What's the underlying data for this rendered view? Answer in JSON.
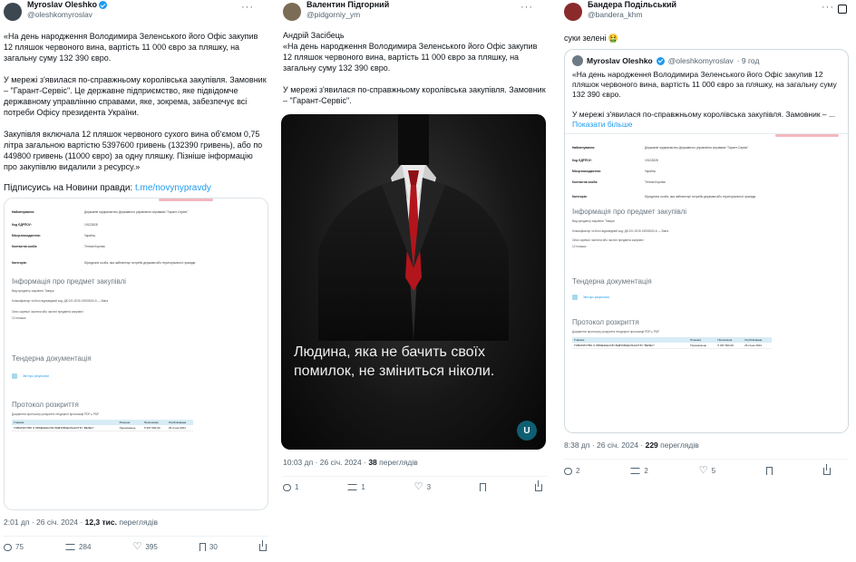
{
  "tweet1": {
    "name": "Myroslav Oleshko",
    "handle": "@oleshkomyroslav",
    "p1": "«На день народження Володимира Зеленського його Офіс закупив 12 пляшок червоного вина, вартість 11 000 євро за пляшку, на загальну суму 132 390 євро.",
    "p2": "У мережі з'явилася по-справжньому королівська закупівля. Замовник – \"Гарант-Сервіс\". Це державне підприємство, яке підвідомче державному управлінню справами, яке, зокрема, забезпечує всі потреби Офісу президента України.",
    "p3": "Закупівля включала 12 пляшок червоного сухого вина об'ємом 0,75 літра загальною вартістю 5397600 гривень (132390 гривень), або по 449800 гривень (11000 євро) за одну пляшку. Пізніше інформацію про закупівлю видалили з ресурсу.»",
    "p4_text": "Підписуись на Новини правди: ",
    "p4_link": "t.me/novynypravdy",
    "time": "2:01 дп · 26 січ. 2024 · ",
    "views": "12,3 тис.",
    "views_label": " переглядів",
    "replies": "75",
    "retweets": "284",
    "likes": "395",
    "bookmarks": "30"
  },
  "tweet2": {
    "name": "Валентин Підгорний",
    "handle": "@pidgorniy_ym",
    "p1": "Андрій Засібець",
    "p2": "«На день народження Володимира Зеленського його Офіс закупив 12 пляшок червоного вина, вартість 11 000 євро за пляшку, на загальну суму 132 390 євро.",
    "p3": "У мережі з'явилася по-справжньому королівська закупівля. Замовник – \"Гарант-Сервіс\".",
    "image_quote": "Людина, яка не бачить своїх помилок, не зміниться ніколи.",
    "logo": "U",
    "time": "10:03 дп · 26 січ. 2024 · ",
    "views": "38",
    "views_label": " переглядів",
    "replies": "1",
    "retweets": "1",
    "likes": "3"
  },
  "tweet3": {
    "name": "Бандера Подільський",
    "handle": "@bandera_khm",
    "text": "суки зелені 🤮",
    "quoted": {
      "name": "Myroslav Oleshko",
      "handle": "@oleshkomyroslav",
      "age": "· 9 год",
      "p1": "«На день народження Володимира Зеленського його Офіс закупив 12 пляшок червоного вина, вартість 11 000 євро за пляшку, на загальну суму 132 390 євро.",
      "p2": "У мережі з'явилася по-справжньому королівська закупівля. Замовник – ...",
      "more": "Показати більше"
    },
    "time": "8:38 дп · 26 січ. 2024 · ",
    "views": "229",
    "views_label": " переглядів",
    "replies": "2",
    "retweets": "2",
    "likes": "5"
  },
  "doc": {
    "rows": [
      {
        "label": "Найменування:",
        "value": "Державне підприємство Державного управління справами \"Гарант-Сервіс\""
      },
      {
        "label": "Код ЄДРПОУ:",
        "value": "19122828"
      },
      {
        "label": "Місцезнаходження:",
        "value": "Україна,"
      },
      {
        "label": "Контактна особа:",
        "value": "Тетяна Корнюк"
      },
      {
        "label": "Категорія:",
        "value": "Юридична особа, яка забезпечує потреби держави або територіальної громади"
      }
    ],
    "section_info": "Інформація про предмет закупівлі",
    "line1": "Вид предмету закупівлі: Товари",
    "line2": "Класифікатор та його відповідний код: ДК 021:2015 15930000-6 — Вина",
    "line3": "Опис окремої частини або частин предмета закупівлі",
    "line4": "12 пляшок",
    "section_tender": "Тендерна документація",
    "file": "Звіт про результати",
    "section_open": "Протокол розкриття",
    "line5": "Документи протоколу розкриття тендерної пропозиції PDF ▸ PDF",
    "table_head": [
      "Учасник",
      "Рішення",
      "Пропозиція",
      "Опублікована"
    ],
    "table_row": [
      "ТОВАРИСТВО З ОБМЕЖЕНОЮ ВІДПОВІДАЛЬНІСТЮ \"ВЕЛЕС\"",
      "Переможець",
      "5 397 600,00",
      "26 січня 2024"
    ]
  },
  "colors": {
    "accent": "#1d9bf0",
    "muted": "#536471",
    "text": "#0f1419"
  }
}
